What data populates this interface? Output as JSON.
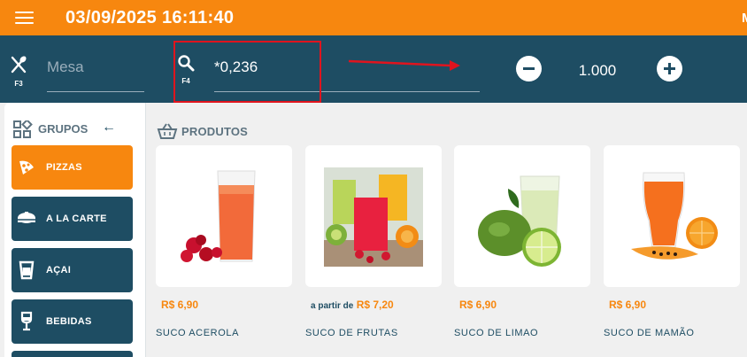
{
  "header": {
    "datetime": "03/09/2025 16:11:40",
    "right_text": "M"
  },
  "toolbar": {
    "mesa_key": "F3",
    "mesa_placeholder": "Mesa",
    "search_key": "F4",
    "search_value": "*0,236",
    "quantity": "1.000"
  },
  "groups": {
    "title": "GRUPOS",
    "items": [
      {
        "label": "PIZZAS",
        "icon": "pizza-icon",
        "active": true
      },
      {
        "label": "A LA CARTE",
        "icon": "dish-icon",
        "active": false
      },
      {
        "label": "AÇAI",
        "icon": "cup-icon",
        "active": false
      },
      {
        "label": "BEBIDAS",
        "icon": "wine-glass-icon",
        "active": false
      }
    ]
  },
  "products": {
    "title": "PRODUTOS",
    "items": [
      {
        "name": "SUCO ACEROLA",
        "price_prefix": "",
        "price": "R$ 6,90",
        "image": "acerola-juice-image"
      },
      {
        "name": "SUCO DE FRUTAS",
        "price_prefix": "a partir de",
        "price": "R$ 7,20",
        "image": "fruit-juices-image"
      },
      {
        "name": "SUCO DE LIMAO",
        "price_prefix": "",
        "price": "R$ 6,90",
        "image": "lime-juice-image"
      },
      {
        "name": "SUCO DE MAMÃO",
        "price_prefix": "",
        "price": "R$ 6,90",
        "image": "papaya-juice-image"
      }
    ]
  },
  "colors": {
    "accent": "#f7870f",
    "primary": "#1e4d63",
    "highlight": "#e0141e"
  }
}
